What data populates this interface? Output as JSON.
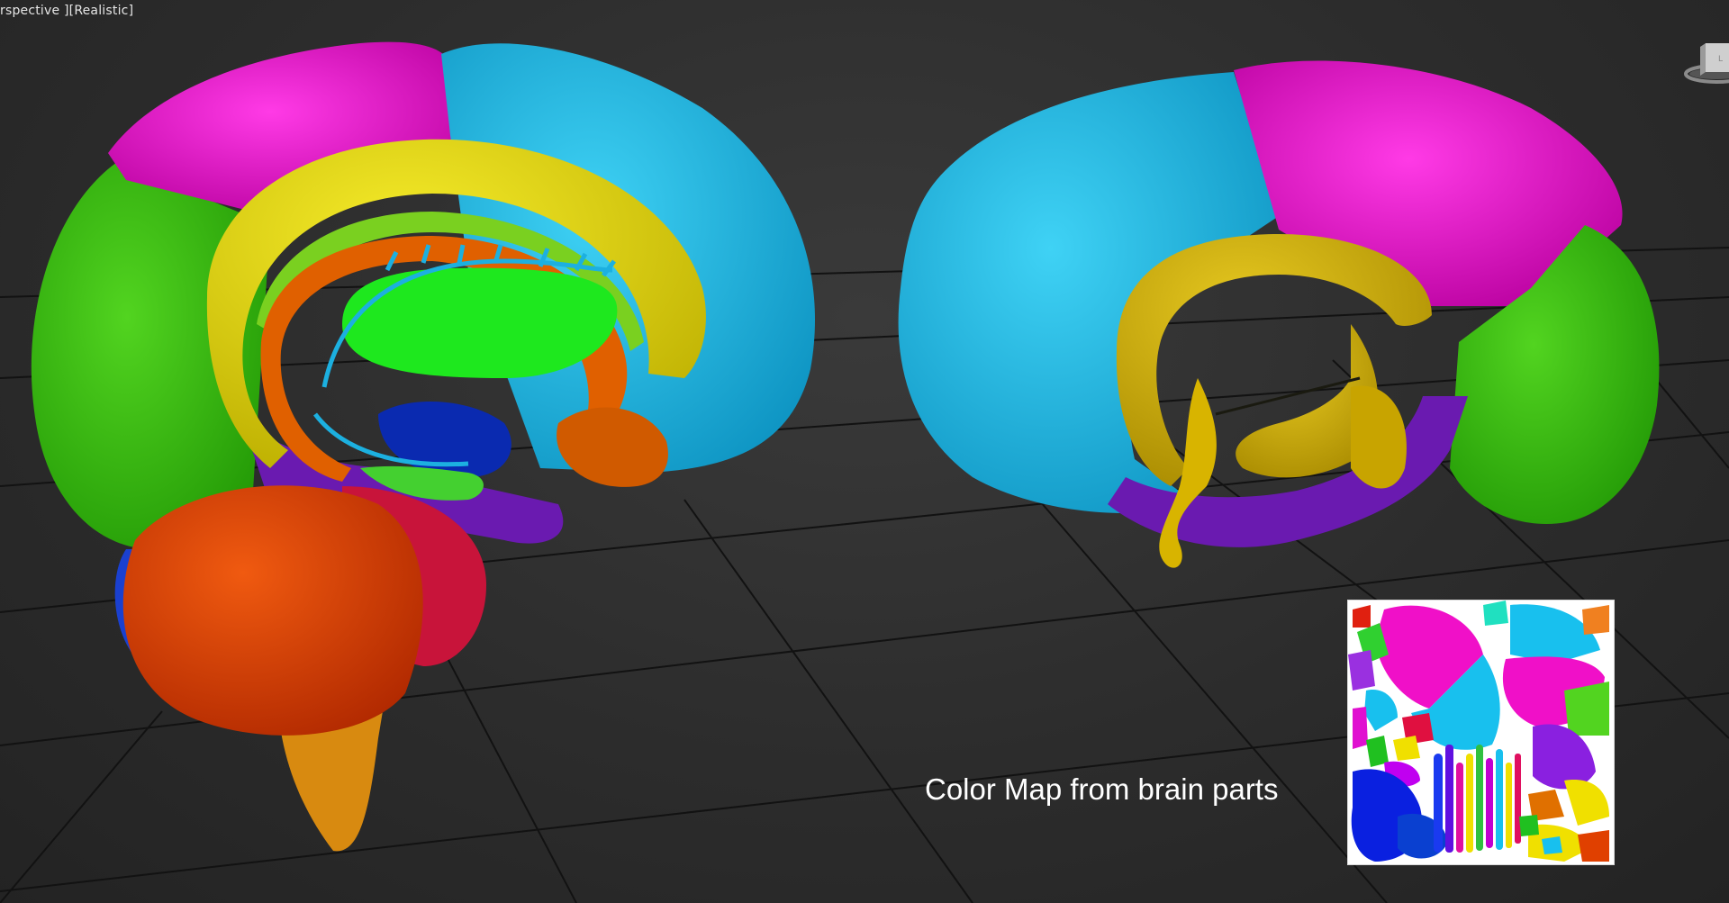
{
  "viewport": {
    "label_fragments": [
      "rspective",
      "Realistic"
    ]
  },
  "caption": "Color Map from brain parts",
  "colors": {
    "background": "#2c2c2c",
    "grid": "#111111",
    "frontal_magenta": "#e00fc8",
    "parietal_cyan": "#18b8e0",
    "occipital_green": "#38c010",
    "corpus_yellow": "#e0d000",
    "thalamus_green": "#1ee81e",
    "fornix_orange": "#e06000",
    "cerebellum_red": "#d83a00",
    "brainstem_orange": "#d88a10",
    "limbic_purple": "#6a1ab0",
    "ventricle_gold": "#d8b400"
  },
  "icons": {
    "viewcube": "viewcube-icon"
  }
}
